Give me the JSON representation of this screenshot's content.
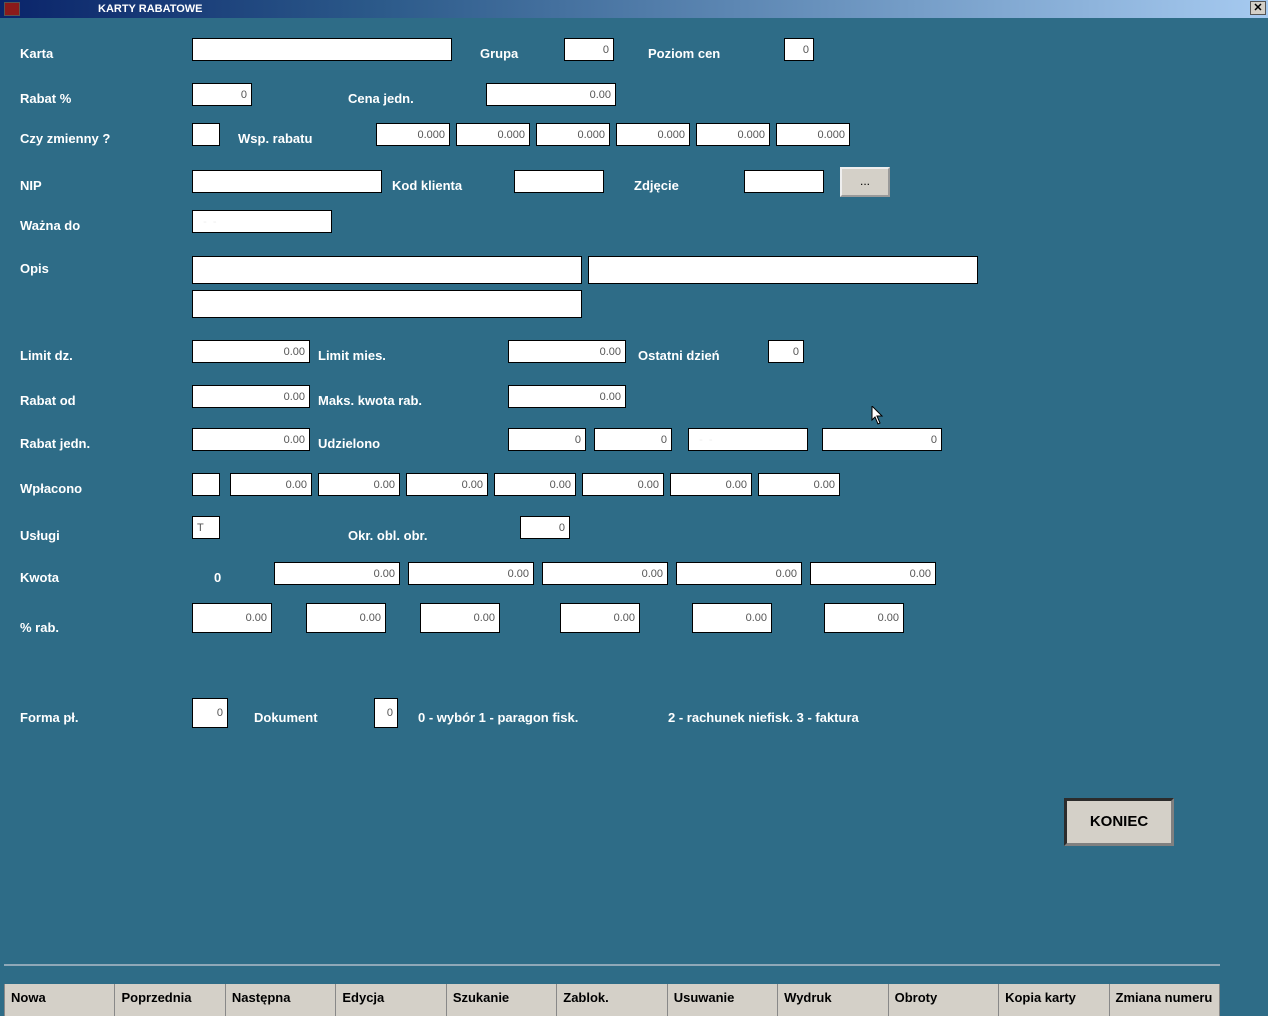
{
  "title": "KARTY RABATOWE",
  "labels": {
    "karta": "Karta",
    "grupa": "Grupa",
    "poziom_cen": "Poziom cen",
    "rabat_pct": "Rabat %",
    "cena_jedn": "Cena jedn.",
    "czy_zmienny": "Czy zmienny ?",
    "wsp_rabatu": "Wsp. rabatu",
    "nip": "NIP",
    "kod_klienta": "Kod klienta",
    "zdjecie": "Zdjęcie",
    "wazna_do": "Ważna do",
    "opis": "Opis",
    "limit_dz": "Limit dz.",
    "limit_mies": "Limit mies.",
    "ostatni_dzien": "Ostatni dzień",
    "rabat_od": "Rabat od",
    "maks_kwota": "Maks. kwota rab.",
    "rabat_jedn": "Rabat jedn.",
    "udzielono": "Udzielono",
    "wplacono": "Wpłacono",
    "uslugi": "Usługi",
    "okr_obl": "Okr. obl. obr.",
    "kwota": "Kwota",
    "pct_rab": "% rab.",
    "forma_pl": "Forma pł.",
    "dokument": "Dokument",
    "doc_hint1": "0 - wybór  1 - paragon fisk.",
    "doc_hint2": "2 - rachunek niefisk.  3 - faktura",
    "koniec": "KONIEC",
    "browse": "..."
  },
  "values": {
    "karta": "",
    "grupa": "0",
    "poziom_cen": "0",
    "rabat_pct": "0",
    "cena_jedn": "0.00",
    "czy_zmienny": "",
    "wsp": [
      "0.000",
      "0.000",
      "0.000",
      "0.000",
      "0.000",
      "0.000"
    ],
    "nip": "",
    "kod_klienta": "",
    "zdjecie": "",
    "wazna_do": "  -  -",
    "opis1": "",
    "opis2": "",
    "opis3": "",
    "limit_dz": "0.00",
    "limit_mies": "0.00",
    "ostatni_dzien": "0",
    "rabat_od": "0.00",
    "maks_kwota": "0.00",
    "rabat_jedn": "0.00",
    "udzielono1": "0",
    "udzielono2": "0",
    "udzielono3": "  -  -",
    "udzielono4": "0",
    "wplacono_flag": "",
    "wplacono": [
      "0.00",
      "0.00",
      "0.00",
      "0.00",
      "0.00",
      "0.00",
      "0.00"
    ],
    "uslugi": "T",
    "okr_obl": "0",
    "kwota0": "0",
    "kwota": [
      "0.00",
      "0.00",
      "0.00",
      "0.00",
      "0.00"
    ],
    "pct_rab": [
      "0.00",
      "0.00",
      "0.00",
      "0.00",
      "0.00",
      "0.00"
    ],
    "forma_pl": "0",
    "dokument": "0"
  },
  "bottom_buttons": [
    "Nowa",
    "Poprzednia",
    "Następna",
    "Edycja",
    "Szukanie",
    "Zablok.",
    "Usuwanie",
    "Wydruk",
    "Obroty",
    "Kopia karty",
    "Zmiana numeru"
  ]
}
